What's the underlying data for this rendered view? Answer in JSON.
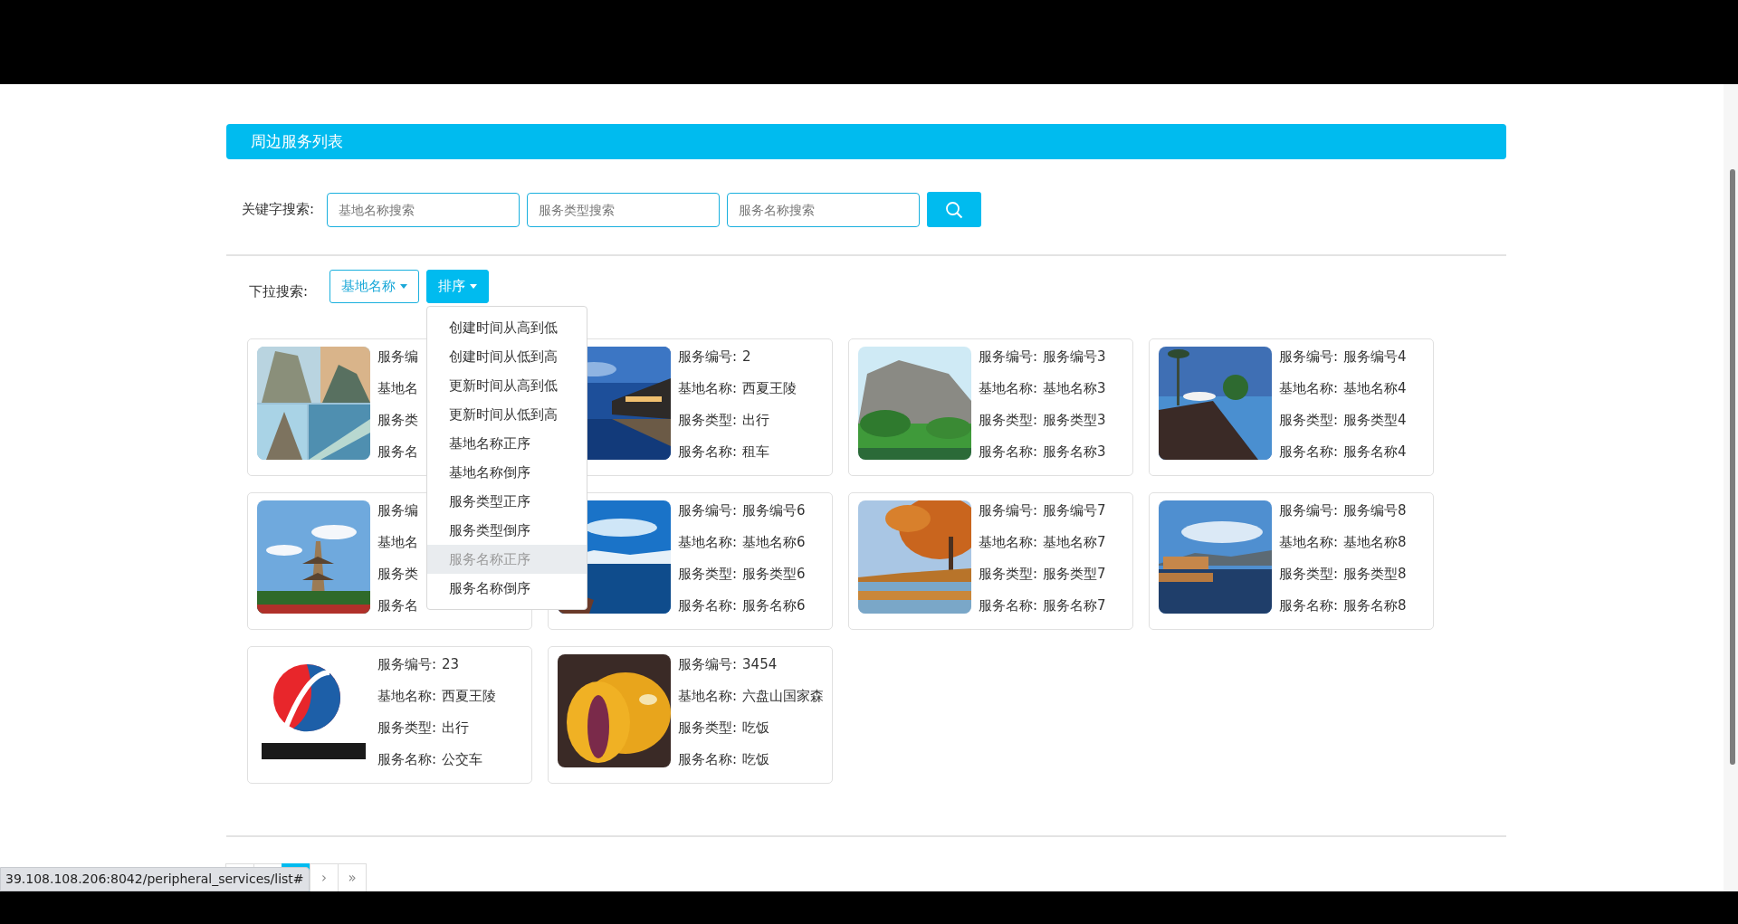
{
  "panel_title": "周边服务列表",
  "keyword_search": {
    "label": "关键字搜索:",
    "fields": [
      {
        "placeholder": "基地名称搜索"
      },
      {
        "placeholder": "服务类型搜索"
      },
      {
        "placeholder": "服务名称搜索"
      }
    ]
  },
  "dropdown_search": {
    "label": "下拉搜索:",
    "buttons": [
      {
        "label": "基地名称",
        "open": false
      },
      {
        "label": "排序",
        "open": true
      }
    ]
  },
  "sort_menu": [
    {
      "label": "创建时间从高到低",
      "highlighted": false
    },
    {
      "label": "创建时间从低到高",
      "highlighted": false
    },
    {
      "label": "更新时间从高到低",
      "highlighted": false
    },
    {
      "label": "更新时间从低到高",
      "highlighted": false
    },
    {
      "label": "基地名称正序",
      "highlighted": false
    },
    {
      "label": "基地名称倒序",
      "highlighted": false
    },
    {
      "label": "服务类型正序",
      "highlighted": false
    },
    {
      "label": "服务类型倒序",
      "highlighted": false
    },
    {
      "label": "服务名称正序",
      "highlighted": true
    },
    {
      "label": "服务名称倒序",
      "highlighted": false
    }
  ],
  "cards": [
    {
      "kind": "picture",
      "fields": [
        {
          "label": "服务编"
        },
        {
          "label": "基地名"
        },
        {
          "label": "服务类"
        },
        {
          "label": "服务名"
        }
      ]
    },
    {
      "kind": "picture",
      "fields": [
        {
          "label": "服务编号:",
          "value": "2"
        },
        {
          "label": "基地名称:",
          "value": "西夏王陵"
        },
        {
          "label": "服务类型:",
          "value": "出行"
        },
        {
          "label": "服务名称:",
          "value": "租车"
        }
      ]
    },
    {
      "kind": "picture",
      "fields": [
        {
          "label": "服务编号:",
          "value": "服务编号3"
        },
        {
          "label": "基地名称:",
          "value": "基地名称3"
        },
        {
          "label": "服务类型:",
          "value": "服务类型3"
        },
        {
          "label": "服务名称:",
          "value": "服务名称3"
        }
      ]
    },
    {
      "kind": "picture",
      "fields": [
        {
          "label": "服务编号:",
          "value": "服务编号4"
        },
        {
          "label": "基地名称:",
          "value": "基地名称4"
        },
        {
          "label": "服务类型:",
          "value": "服务类型4"
        },
        {
          "label": "服务名称:",
          "value": "服务名称4"
        }
      ]
    },
    {
      "kind": "picture",
      "fields": [
        {
          "label": "服务编"
        },
        {
          "label": "基地名"
        },
        {
          "label": "服务类"
        },
        {
          "label": "服务名"
        }
      ]
    },
    {
      "kind": "picture",
      "fields": [
        {
          "label": "服务编号:",
          "value": "服务编号6"
        },
        {
          "label": "基地名称:",
          "value": "基地名称6"
        },
        {
          "label": "服务类型:",
          "value": "服务类型6"
        },
        {
          "label": "服务名称:",
          "value": "服务名称6"
        }
      ]
    },
    {
      "kind": "picture",
      "fields": [
        {
          "label": "服务编号:",
          "value": "服务编号7"
        },
        {
          "label": "基地名称:",
          "value": "基地名称7"
        },
        {
          "label": "服务类型:",
          "value": "服务类型7"
        },
        {
          "label": "服务名称:",
          "value": "服务名称7"
        }
      ]
    },
    {
      "kind": "picture",
      "fields": [
        {
          "label": "服务编号:",
          "value": "服务编号8"
        },
        {
          "label": "基地名称:",
          "value": "基地名称8"
        },
        {
          "label": "服务类型:",
          "value": "服务类型8"
        },
        {
          "label": "服务名称:",
          "value": "服务名称8"
        }
      ]
    },
    {
      "kind": "picture",
      "fields": [
        {
          "label": "服务编号:",
          "value": "23"
        },
        {
          "label": "基地名称:",
          "value": "西夏王陵"
        },
        {
          "label": "服务类型:",
          "value": "出行"
        },
        {
          "label": "服务名称:",
          "value": "公交车"
        }
      ]
    },
    {
      "kind": "picture",
      "fields": [
        {
          "label": "服务编号:",
          "value": "3454"
        },
        {
          "label": "基地名称:",
          "value": "六盘山国家森"
        },
        {
          "label": "服务类型:",
          "value": "吃饭"
        },
        {
          "label": "服务名称:",
          "value": "吃饭"
        }
      ]
    }
  ],
  "pagination": [
    {
      "selected": false
    },
    {
      "selected": false
    },
    {
      "selected": true
    },
    {
      "label": "›",
      "selected": false
    },
    {
      "label": "»",
      "selected": false
    }
  ],
  "status_url": "39.108.108.206:8042/peripheral_services/list#"
}
